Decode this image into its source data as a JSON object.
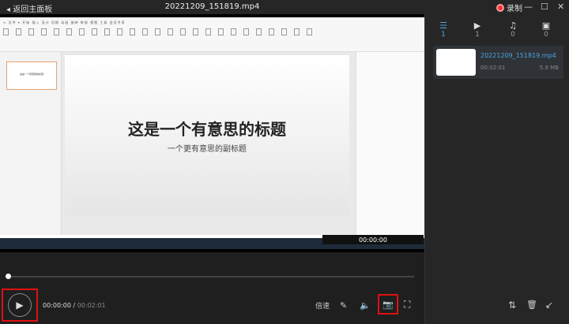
{
  "titlebar": {
    "back_label": "◂ 返回主面板",
    "video_title": "20221209_151819.mp4",
    "record_label": "录制",
    "minimize": "—",
    "maximize": "☐",
    "close": "✕"
  },
  "video": {
    "slide_title": "这是一个有意思的标题",
    "slide_subtitle": "一个更有意思的副标题",
    "thumb_title": "这是一个有意思的标题",
    "overlay_time": "00:00:00"
  },
  "sidebar": {
    "tabs": [
      {
        "icon": "☰",
        "count": "1"
      },
      {
        "icon": "▶",
        "count": "1"
      },
      {
        "icon": "♫",
        "count": "0"
      },
      {
        "icon": "▣",
        "count": "0"
      }
    ],
    "file": {
      "name": "20221209_151819.mp4",
      "duration": "00:02:01",
      "size": "5.9 MB"
    },
    "actions": {
      "sort": "⇅",
      "delete": "🗑",
      "export": "↙"
    }
  },
  "player": {
    "current_time": "00:00:00",
    "separator": " / ",
    "total_time": "00:02:01",
    "speed_label": "倍速",
    "progress": 0,
    "play_icon": "▶",
    "brush": "✎",
    "volume": "🔈",
    "camera": "📷",
    "fullscreen": "⛶"
  }
}
